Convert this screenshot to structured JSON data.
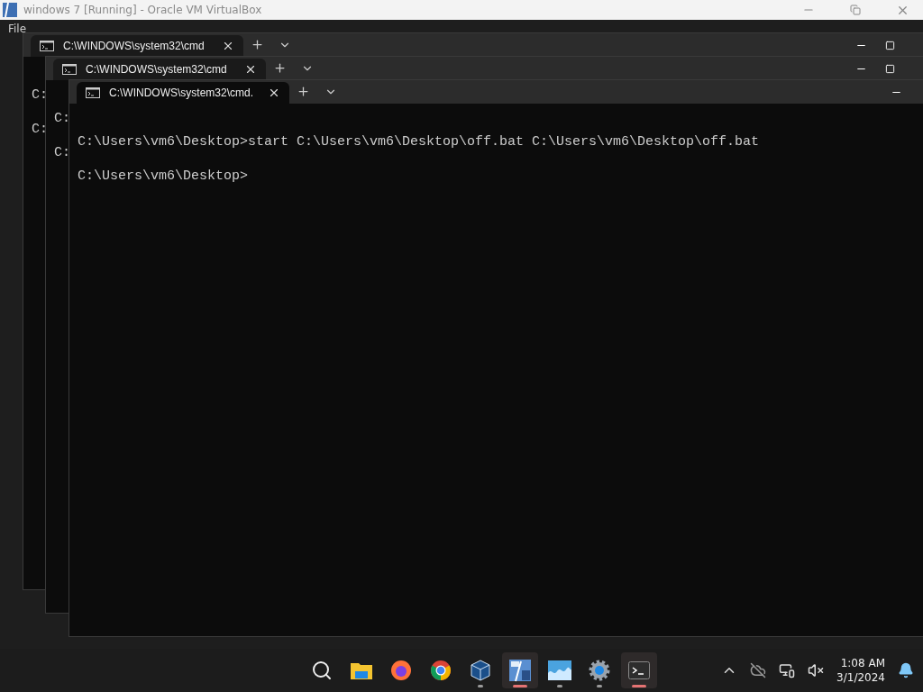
{
  "host_window": {
    "title": "windows 7 [Running] - Oracle VM VirtualBox",
    "menu": [
      "File"
    ]
  },
  "terminal_windows": [
    {
      "tab_title": "C:\\WINDOWS\\system32\\cmd",
      "lines": [
        "C:",
        "C:"
      ],
      "focused": false,
      "maximize_shown": true
    },
    {
      "tab_title": "C:\\WINDOWS\\system32\\cmd",
      "lines": [
        "C:",
        "C:"
      ],
      "focused": false,
      "maximize_shown": true
    },
    {
      "tab_title": "C:\\WINDOWS\\system32\\cmd.",
      "lines": [
        "C:\\Users\\vm6\\Desktop>start C:\\Users\\vm6\\Desktop\\off.bat C:\\Users\\vm6\\Desktop\\off.bat",
        "C:\\Users\\vm6\\Desktop>"
      ],
      "focused": true,
      "maximize_shown": false
    }
  ],
  "taskbar": {
    "apps": [
      {
        "kind": "search",
        "selected": false,
        "running": false
      },
      {
        "kind": "folder",
        "selected": false,
        "running": false
      },
      {
        "kind": "firefox",
        "selected": false,
        "running": false
      },
      {
        "kind": "chrome",
        "selected": false,
        "running": false
      },
      {
        "kind": "cube",
        "selected": false,
        "running": true
      },
      {
        "kind": "vbox",
        "selected": true,
        "running": true
      },
      {
        "kind": "wave",
        "selected": false,
        "running": true
      },
      {
        "kind": "gear",
        "selected": false,
        "running": true
      },
      {
        "kind": "terminal",
        "selected": true,
        "running": true
      }
    ],
    "tray": [
      {
        "kind": "chevron"
      },
      {
        "kind": "cloud-off"
      },
      {
        "kind": "network"
      },
      {
        "kind": "muted"
      }
    ],
    "clock": {
      "time": "1:08 AM",
      "date": "3/1/2024"
    },
    "notifications": true
  }
}
